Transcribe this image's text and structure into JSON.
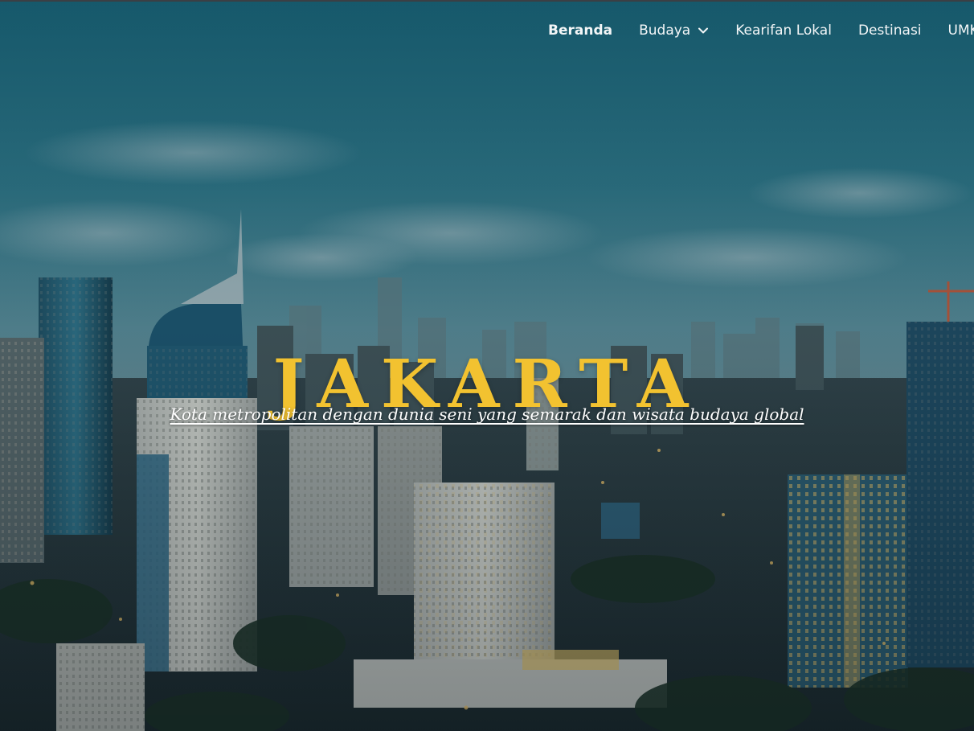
{
  "nav": {
    "items": [
      {
        "label": "Beranda",
        "active": true,
        "dropdown": false
      },
      {
        "label": "Budaya",
        "active": false,
        "dropdown": true
      },
      {
        "label": "Kearifan Lokal",
        "active": false,
        "dropdown": false
      },
      {
        "label": "Destinasi",
        "active": false,
        "dropdown": false
      },
      {
        "label": "UMKM",
        "active": false,
        "dropdown": false
      }
    ],
    "dropdown_icon": "chevron-down-icon"
  },
  "hero": {
    "title": "JAKARTA",
    "subtitle": "Kota metropolitan dengan dunia seni yang semarak dan wisata budaya global",
    "background": "jakarta-skyline-photo"
  },
  "colors": {
    "title": "#f2c230",
    "nav_text": "#ffffff",
    "sky_top": "#1f6a7a",
    "sky_mid": "#4f8a96"
  }
}
